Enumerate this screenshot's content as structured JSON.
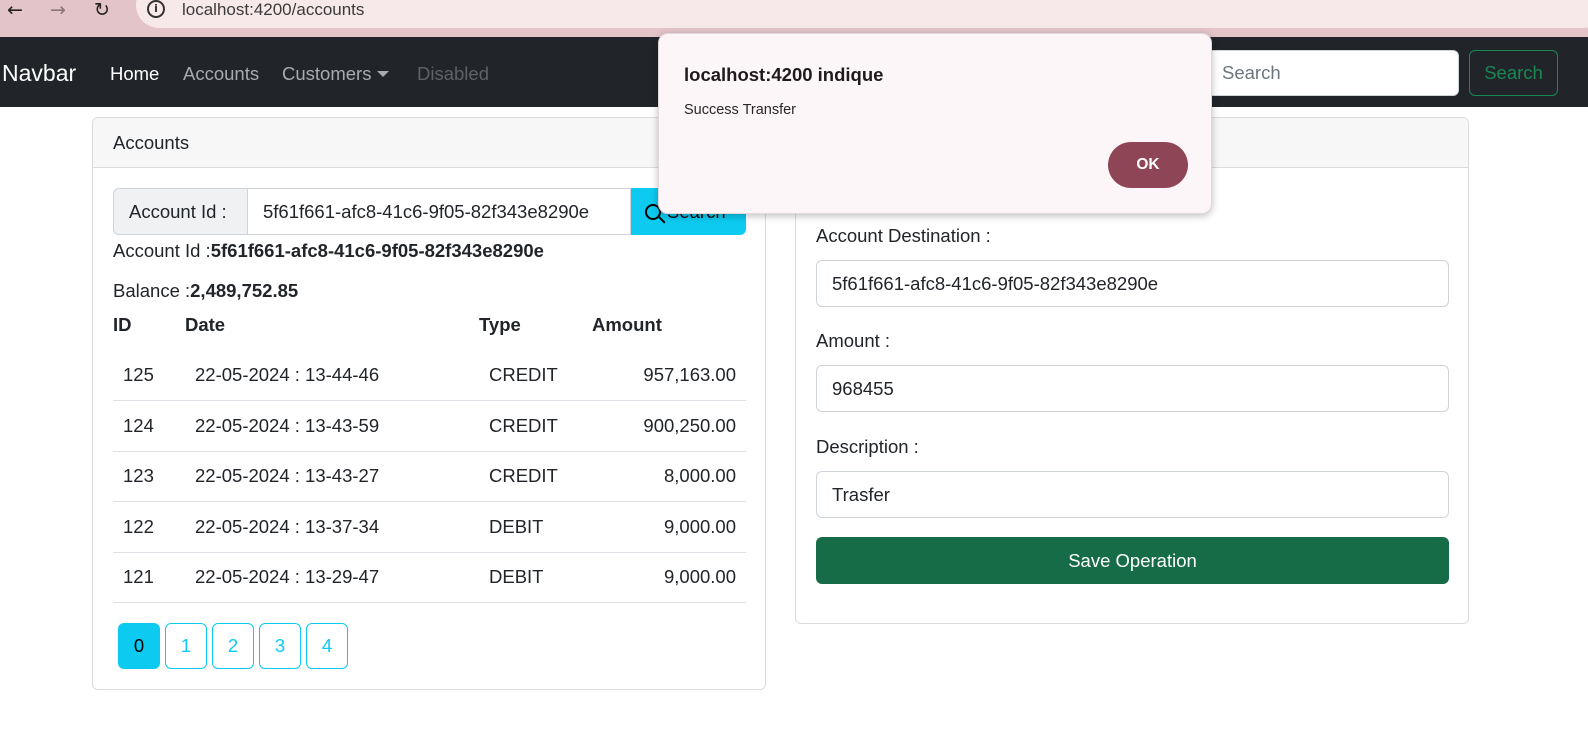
{
  "browser": {
    "back_icon": "←",
    "forward_icon": "→",
    "reload_icon": "↻",
    "info_icon": "i",
    "url": "localhost:4200/accounts"
  },
  "navbar": {
    "brand": "Navbar",
    "links": [
      {
        "label": "Home"
      },
      {
        "label": "Accounts"
      },
      {
        "label": "Customers"
      },
      {
        "label": "Disabled"
      }
    ],
    "search_placeholder": "Search",
    "search_button": "Search"
  },
  "accounts_card": {
    "header": "Accounts",
    "account_id_label": "Account Id :",
    "account_id_value": "5f61f661-afc8-41c6-9f05-82f343e8290e",
    "search_button": "Search",
    "account_line_label": "Account Id :",
    "account_line_value": "5f61f661-afc8-41c6-9f05-82f343e8290e",
    "balance_label": "Balance :",
    "balance_value": "2,489,752.85",
    "table": {
      "headers": [
        "ID",
        "Date",
        "Type",
        "Amount"
      ],
      "rows": [
        {
          "id": "125",
          "date": "22-05-2024 : 13-44-46",
          "type": "CREDIT",
          "amount": "957,163.00"
        },
        {
          "id": "124",
          "date": "22-05-2024 : 13-43-59",
          "type": "CREDIT",
          "amount": "900,250.00"
        },
        {
          "id": "123",
          "date": "22-05-2024 : 13-43-27",
          "type": "CREDIT",
          "amount": "8,000.00"
        },
        {
          "id": "122",
          "date": "22-05-2024 : 13-37-34",
          "type": "DEBIT",
          "amount": "9,000.00"
        },
        {
          "id": "121",
          "date": "22-05-2024 : 13-29-47",
          "type": "DEBIT",
          "amount": "9,000.00"
        }
      ]
    },
    "pages": [
      "0",
      "1",
      "2",
      "3",
      "4"
    ],
    "active_page": "0"
  },
  "operation_card": {
    "destination_label": "Account Destination :",
    "destination_value": "5f61f661-afc8-41c6-9f05-82f343e8290e",
    "amount_label": "Amount :",
    "amount_value": "968455",
    "description_label": "Description :",
    "description_value": "Trasfer",
    "save_button": "Save Operation"
  },
  "dialog": {
    "title": "localhost:4200 indique",
    "message": "Success Transfer",
    "ok_button": "OK"
  },
  "colors": {
    "navbar_bg": "#212529",
    "info": "#0dcaf0",
    "success": "#198754",
    "save_button": "#176c48",
    "dialog_ok": "#8e4556",
    "browser_bar": "#e3c4c9"
  }
}
